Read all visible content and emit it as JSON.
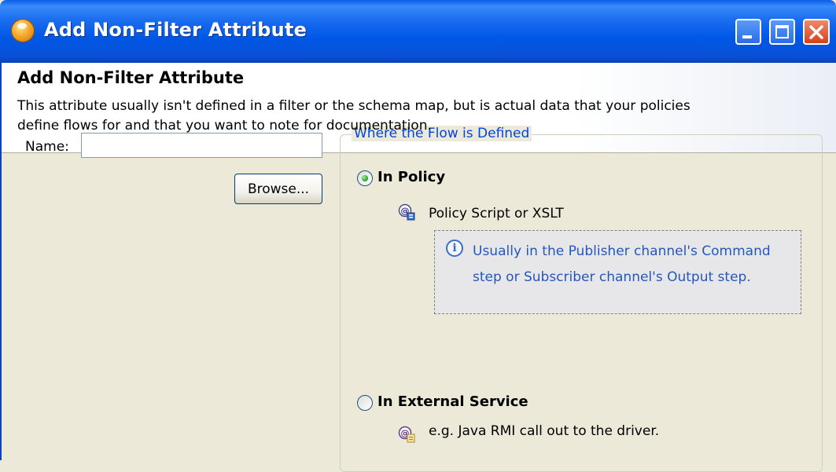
{
  "window": {
    "title": "Add Non-Filter Attribute"
  },
  "header": {
    "title": "Add Non-Filter Attribute",
    "description": "This attribute usually isn't defined in a filter or the schema map, but is actual data that your policies define flows for and that you want to note for documentation."
  },
  "form": {
    "name_label": "Name:",
    "name_value": "",
    "browse_label": "Browse..."
  },
  "flow_group": {
    "legend": "Where the Flow is Defined",
    "options": [
      {
        "label": "In Policy",
        "checked": true,
        "sub_text": "Policy Script or XSLT",
        "info": "Usually in the Publisher channel's Command step or Subscriber channel's Output step."
      },
      {
        "label": "In External Service",
        "checked": false,
        "sub_text": "e.g. Java RMI call out to the driver."
      }
    ]
  },
  "colors": {
    "titlebar": "#0058e6",
    "legend_text": "#0046d5",
    "info_text": "#2458b8",
    "dialog_bg": "#ece9d8"
  }
}
